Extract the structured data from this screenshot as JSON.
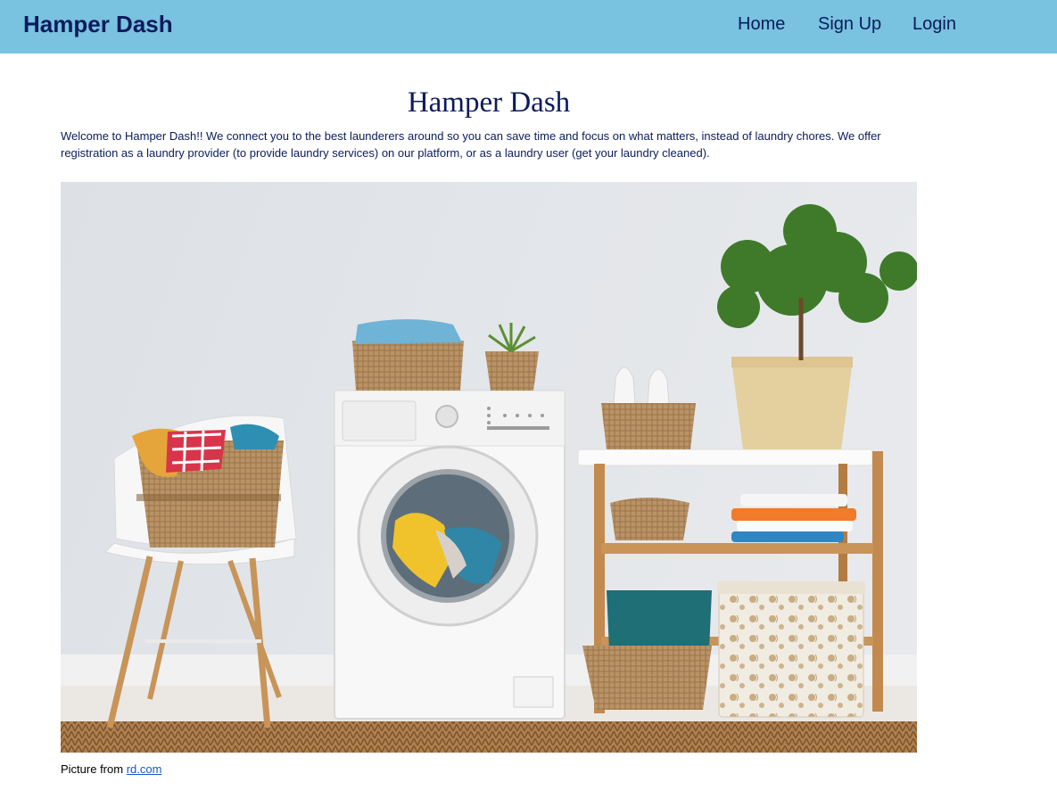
{
  "navbar": {
    "brand": "Hamper Dash",
    "links": [
      {
        "label": "Home"
      },
      {
        "label": "Sign Up"
      },
      {
        "label": "Login"
      }
    ]
  },
  "main": {
    "title": "Hamper Dash",
    "intro": "Welcome to Hamper Dash!! We connect you to the best launderers around so you can save time and focus on what matters, instead of laundry chores. We offer registration as a laundry provider (to provide laundry services) on our platform, or as a laundry user (get your laundry cleaned).",
    "image_caption_prefix": "Picture from",
    "image_caption_link": "rd.com"
  },
  "colors": {
    "navbar_bg": "#79c2e0",
    "text": "#0b1b5c",
    "link": "#1a56c9"
  }
}
